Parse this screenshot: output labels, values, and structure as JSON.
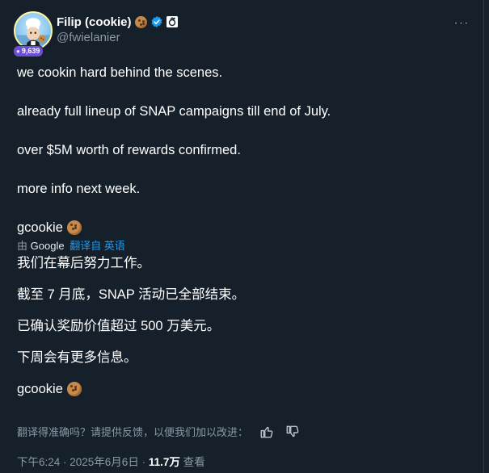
{
  "author": {
    "display_name": "Filip (cookie)",
    "handle": "@fwielanier",
    "follower_badge": "9,639",
    "avatar_icon": "chef-cookie-avatar",
    "name_emoji": "cookie-emoji",
    "verified_icon": "verified-badge-icon",
    "affiliate_icon": "affiliate-badge-icon"
  },
  "more_label": "···",
  "original": {
    "p1": "we cookin hard behind the scenes.",
    "p2": "already full lineup of SNAP campaigns till end of July.",
    "p3": "over $5M worth of rewards confirmed.",
    "p4": "more info next week.",
    "p5": "gcookie"
  },
  "translation": {
    "by_prefix": "由",
    "by_provider": "Google",
    "link_label": "翻译自 英语",
    "p1": "我们在幕后努力工作。",
    "p2": "截至 7 月底，SNAP 活动已全部结束。",
    "p3": "已确认奖励价值超过 500 万美元。",
    "p4": "下周会有更多信息。",
    "p5": "gcookie"
  },
  "feedback": {
    "prompt": "翻译得准确吗？请提供反馈，以便我们加以改进：",
    "thumbs_up_icon": "thumbs-up-icon",
    "thumbs_down_icon": "thumbs-down-icon"
  },
  "meta": {
    "time_date": "下午6:24 · 2025年6月6日 · ",
    "views": "11.7万",
    "views_suffix": " 查看"
  },
  "colors": {
    "background": "#15202b",
    "text": "#ffffff",
    "secondary": "#8b98a5",
    "link": "#1d9bf0",
    "badge": "#6d4ed6"
  }
}
